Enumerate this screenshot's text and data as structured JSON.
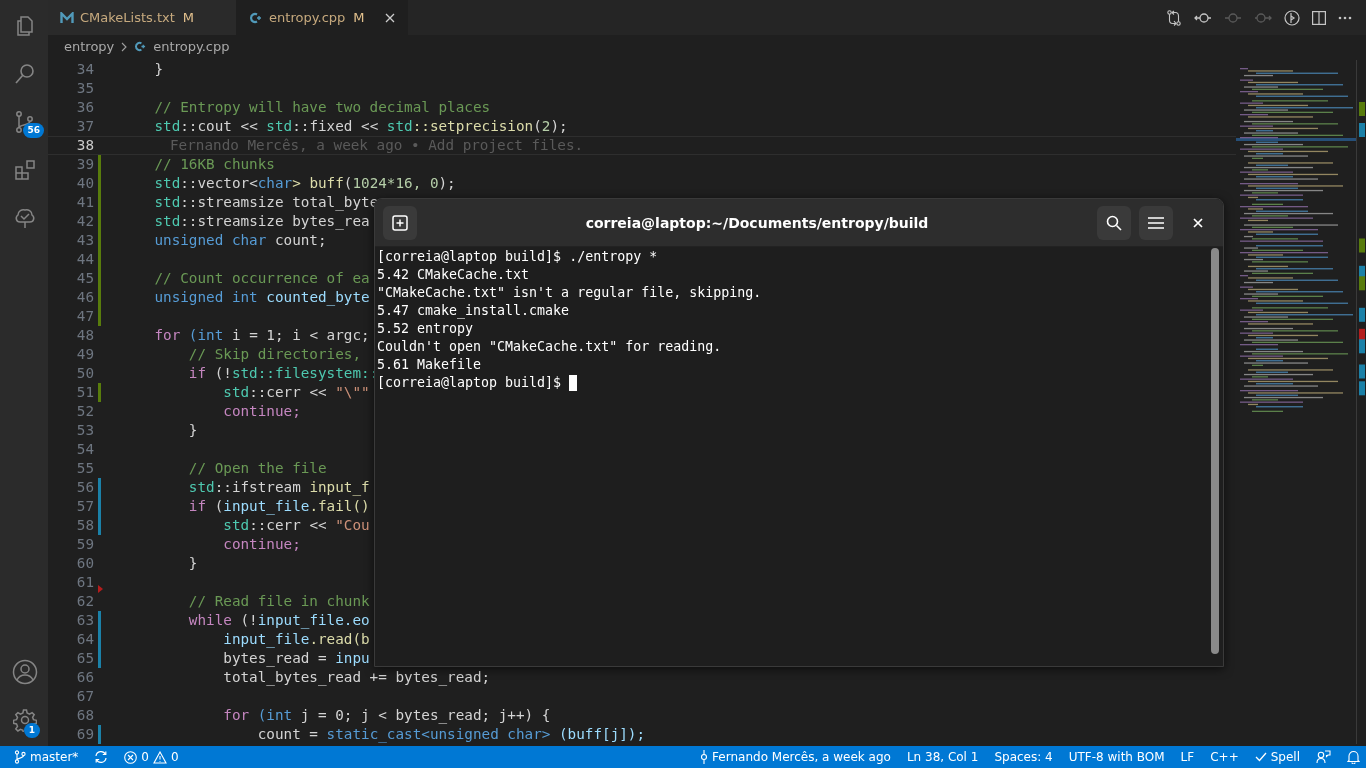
{
  "activity_bar": {
    "top": [
      {
        "kind": "files",
        "selected": false
      },
      {
        "kind": "search",
        "selected": false
      },
      {
        "kind": "source-control",
        "selected": false,
        "badge": "56"
      },
      {
        "kind": "extensions",
        "selected": false
      },
      {
        "kind": "testing",
        "selected": false
      }
    ],
    "bottom": [
      {
        "kind": "account"
      },
      {
        "kind": "settings",
        "badge": "1"
      }
    ]
  },
  "tabs": [
    {
      "label": "CMakeLists.txt",
      "status": "M",
      "kind": "cmake",
      "selected": false
    },
    {
      "label": "entropy.cpp",
      "status": "M",
      "kind": "cpp",
      "selected": true
    }
  ],
  "editor_actions": [
    {
      "kind": "compare",
      "disabled": false
    },
    {
      "kind": "prev",
      "disabled": false
    },
    {
      "kind": "dot",
      "disabled": true
    },
    {
      "kind": "next",
      "disabled": true
    },
    {
      "kind": "blame",
      "disabled": false
    },
    {
      "kind": "split",
      "disabled": false
    },
    {
      "kind": "more",
      "disabled": false
    }
  ],
  "breadcrumb": [
    {
      "label": "entropy",
      "kind": "folder"
    },
    {
      "label": "entropy.cpp",
      "kind": "cpp"
    }
  ],
  "code_lines": [
    {
      "n": "34",
      "current": false,
      "kind": "plain",
      "tokens": [
        {
          "kind": "p",
          "text": "    }"
        }
      ]
    },
    {
      "n": "35",
      "current": false,
      "kind": "plain"
    },
    {
      "n": "36",
      "current": false,
      "kind": "plain",
      "tokens": [
        {
          "kind": "c",
          "text": "    // Entropy will have two decimal places"
        }
      ]
    },
    {
      "n": "37",
      "current": false,
      "kind": "plain",
      "tokens": [
        {
          "kind": "ns",
          "text": "    std"
        },
        {
          "kind": "p",
          "text": "::cout << "
        },
        {
          "kind": "ns",
          "text": "std"
        },
        {
          "kind": "p",
          "text": "::fixed << "
        },
        {
          "kind": "ns",
          "text": "std"
        },
        {
          "kind": "fn",
          "text": "::setprecision"
        },
        {
          "kind": "p",
          "text": "("
        },
        {
          "kind": "num",
          "text": "2"
        },
        {
          "kind": "p",
          "text": ");"
        }
      ]
    },
    {
      "n": "38",
      "current": true,
      "kind": "plain",
      "blame": "Fernando Mercês, a week ago • Add project files."
    },
    {
      "n": "39",
      "current": false,
      "kind": "added",
      "tokens": [
        {
          "kind": "c",
          "text": "    // 16KB chunks"
        }
      ]
    },
    {
      "n": "40",
      "current": false,
      "kind": "added",
      "tokens": [
        {
          "kind": "ns",
          "text": "    std"
        },
        {
          "kind": "p",
          "text": "::vector<"
        },
        {
          "kind": "ty",
          "text": "char"
        },
        {
          "kind": "fn",
          "text": "> buff"
        },
        {
          "kind": "p",
          "text": "("
        },
        {
          "kind": "num",
          "text": "1024*16, 0"
        },
        {
          "kind": "p",
          "text": ");"
        }
      ]
    },
    {
      "n": "41",
      "current": false,
      "kind": "added",
      "tokens": [
        {
          "kind": "ns",
          "text": "    std"
        },
        {
          "kind": "p",
          "text": "::streamsize total_byte"
        }
      ]
    },
    {
      "n": "42",
      "current": false,
      "kind": "added",
      "tokens": [
        {
          "kind": "ns",
          "text": "    std"
        },
        {
          "kind": "p",
          "text": "::streamsize bytes_rea"
        }
      ]
    },
    {
      "n": "43",
      "current": false,
      "kind": "added",
      "tokens": [
        {
          "kind": "ty",
          "text": "    unsigned char"
        },
        {
          "kind": "p",
          "text": " count;"
        }
      ]
    },
    {
      "n": "44",
      "current": false,
      "kind": "added"
    },
    {
      "n": "45",
      "current": false,
      "kind": "added",
      "tokens": [
        {
          "kind": "c",
          "text": "    // Count occurrence of ea"
        }
      ]
    },
    {
      "n": "46",
      "current": false,
      "kind": "added",
      "tokens": [
        {
          "kind": "ty",
          "text": "    unsigned int"
        },
        {
          "kind": "v",
          "text": " counted_byte"
        }
      ]
    },
    {
      "n": "47",
      "current": false,
      "kind": "added"
    },
    {
      "n": "48",
      "current": false,
      "kind": "plain",
      "tokens": [
        {
          "kind": "kw",
          "text": "    for"
        },
        {
          "kind": "ty",
          "text": " (int"
        },
        {
          "kind": "p",
          "text": " i = 1; i < argc;"
        }
      ]
    },
    {
      "n": "49",
      "current": false,
      "kind": "plain",
      "tokens": [
        {
          "kind": "c",
          "text": "        // Skip directories,"
        }
      ]
    },
    {
      "n": "50",
      "current": false,
      "kind": "plain",
      "tokens": [
        {
          "kind": "kw",
          "text": "        if"
        },
        {
          "kind": "p",
          "text": " (!"
        },
        {
          "kind": "ns",
          "text": "std::filesystem::"
        }
      ]
    },
    {
      "n": "51",
      "current": false,
      "kind": "added",
      "tokens": [
        {
          "kind": "ns",
          "text": "            std"
        },
        {
          "kind": "p",
          "text": "::cerr << "
        },
        {
          "kind": "str",
          "text": "\"\\\"\""
        }
      ]
    },
    {
      "n": "52",
      "current": false,
      "kind": "plain",
      "tokens": [
        {
          "kind": "kw",
          "text": "            continue;"
        }
      ]
    },
    {
      "n": "53",
      "current": false,
      "kind": "plain",
      "tokens": [
        {
          "kind": "p",
          "text": "        }"
        }
      ]
    },
    {
      "n": "54",
      "current": false,
      "kind": "plain"
    },
    {
      "n": "55",
      "current": false,
      "kind": "plain",
      "tokens": [
        {
          "kind": "c",
          "text": "        // Open the file"
        }
      ]
    },
    {
      "n": "56",
      "current": false,
      "kind": "modified",
      "tokens": [
        {
          "kind": "ns",
          "text": "        std"
        },
        {
          "kind": "p",
          "text": "::ifstream "
        },
        {
          "kind": "fn",
          "text": "input_f"
        }
      ]
    },
    {
      "n": "57",
      "current": false,
      "kind": "modified",
      "tokens": [
        {
          "kind": "kw",
          "text": "        if"
        },
        {
          "kind": "p",
          "text": " ("
        },
        {
          "kind": "v",
          "text": "input_file"
        },
        {
          "kind": "fn",
          "text": ".fail()"
        }
      ]
    },
    {
      "n": "58",
      "current": false,
      "kind": "modified",
      "tokens": [
        {
          "kind": "ns",
          "text": "            std"
        },
        {
          "kind": "p",
          "text": "::cerr << "
        },
        {
          "kind": "str",
          "text": "\"Cou"
        }
      ]
    },
    {
      "n": "59",
      "current": false,
      "kind": "plain",
      "tokens": [
        {
          "kind": "kw",
          "text": "            continue;"
        }
      ]
    },
    {
      "n": "60",
      "current": false,
      "kind": "plain",
      "tokens": [
        {
          "kind": "p",
          "text": "        }"
        }
      ]
    },
    {
      "n": "61",
      "current": false,
      "kind": "deleted"
    },
    {
      "n": "62",
      "current": false,
      "kind": "plain",
      "tokens": [
        {
          "kind": "c",
          "text": "        // Read file in chunk"
        }
      ]
    },
    {
      "n": "63",
      "current": false,
      "kind": "modified",
      "tokens": [
        {
          "kind": "kw",
          "text": "        while"
        },
        {
          "kind": "p",
          "text": " (!"
        },
        {
          "kind": "v",
          "text": "input_file.eo"
        }
      ]
    },
    {
      "n": "64",
      "current": false,
      "kind": "modified",
      "tokens": [
        {
          "kind": "v",
          "text": "            input_file"
        },
        {
          "kind": "fn",
          "text": ".read(b"
        }
      ]
    },
    {
      "n": "65",
      "current": false,
      "kind": "modified",
      "tokens": [
        {
          "kind": "p",
          "text": "            bytes_read = "
        },
        {
          "kind": "v",
          "text": "inpu"
        }
      ]
    },
    {
      "n": "66",
      "current": false,
      "kind": "plain",
      "tokens": [
        {
          "kind": "p",
          "text": "            total_bytes_read += bytes_read;"
        }
      ]
    },
    {
      "n": "67",
      "current": false,
      "kind": "plain"
    },
    {
      "n": "68",
      "current": false,
      "kind": "plain",
      "tokens": [
        {
          "kind": "kw",
          "text": "            for"
        },
        {
          "kind": "ty",
          "text": " (int"
        },
        {
          "kind": "p",
          "text": " j = 0; j < bytes_read; j++) {"
        }
      ]
    },
    {
      "n": "69",
      "current": false,
      "kind": "modified",
      "tokens": [
        {
          "kind": "p",
          "text": "                count = "
        },
        {
          "kind": "ty",
          "text": "static_cast<unsigned char>"
        },
        {
          "kind": "v",
          "text": " (buff[j]);"
        }
      ]
    }
  ],
  "terminal": {
    "title": "correia@laptop:~/Documents/entropy/build",
    "lines": [
      "[correia@laptop build]$ ./entropy *",
      "5.42 CMakeCache.txt",
      "\"CMakeCache.txt\" isn't a regular file, skipping.",
      "5.47 cmake_install.cmake",
      "5.52 entropy",
      "Couldn't open \"CMakeCache.txt\" for reading.",
      "5.61 Makefile",
      "[correia@laptop build]$ "
    ],
    "cursor": true
  },
  "status_bar": {
    "left": [
      {
        "kind": "branch",
        "label": "master*"
      },
      {
        "kind": "sync"
      },
      {
        "kind": "problems",
        "errors": "0",
        "warnings": "0"
      }
    ],
    "right": [
      {
        "kind": "blame",
        "label": "Fernando Mercês, a week ago"
      },
      {
        "kind": "text",
        "label": "Ln 38, Col 1"
      },
      {
        "kind": "text",
        "label": "Spaces: 4"
      },
      {
        "kind": "text",
        "label": "UTF-8 with BOM"
      },
      {
        "kind": "text",
        "label": "LF"
      },
      {
        "kind": "text",
        "label": "C++"
      },
      {
        "kind": "spell",
        "label": "Spell"
      },
      {
        "kind": "feedback"
      },
      {
        "kind": "bell"
      }
    ]
  }
}
